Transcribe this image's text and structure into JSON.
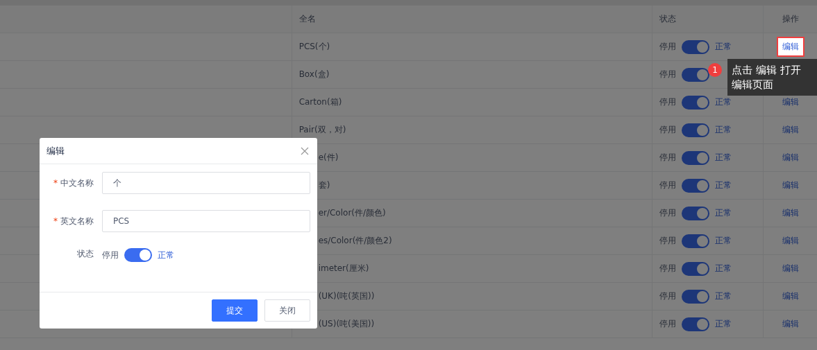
{
  "table": {
    "columns": [
      {
        "label": "全名"
      },
      {
        "label": "状态"
      },
      {
        "label": "操作"
      }
    ],
    "rows": [
      {
        "name": "PCS(个)",
        "covered": false,
        "off_label": "停用",
        "on": true,
        "on_label": "正常",
        "action": "编辑",
        "highlighted": true
      },
      {
        "name": "Box(盒)",
        "covered": false,
        "off_label": "停用",
        "on": true
      },
      {
        "name": "Carton(箱)",
        "covered": false,
        "off_label": "停用",
        "on": true,
        "on_label": "正常",
        "action": "编辑",
        "highlighted": false
      },
      {
        "name": "Pair(双，对)",
        "covered": false,
        "off_label": "停用",
        "on": true,
        "on_label": "正常",
        "action": "编辑",
        "highlighted": false
      },
      {
        "name": "e(件)",
        "covered": true,
        "off_label": "停用",
        "on": true,
        "on_label": "正常",
        "action": "编辑",
        "highlighted": false
      },
      {
        "name": "套)",
        "covered": true,
        "off_label": "停用",
        "on": true,
        "on_label": "正常",
        "action": "编辑",
        "highlighted": false
      },
      {
        "name": "er/Color(件/颜色)",
        "covered": true,
        "off_label": "停用",
        "on": true,
        "on_label": "正常",
        "action": "编辑",
        "highlighted": false
      },
      {
        "name": "es/Color(件/颜色2)",
        "covered": true,
        "off_label": "停用",
        "on": true,
        "on_label": "正常",
        "action": "编辑",
        "highlighted": false
      },
      {
        "name": "imeter(厘米)",
        "covered": true,
        "off_label": "停用",
        "on": true,
        "on_label": "正常",
        "action": "编辑",
        "highlighted": false
      },
      {
        "name": "(UK)(吨(英国))",
        "covered": true,
        "off_label": "停用",
        "on": true,
        "on_label": "正常",
        "action": "编辑",
        "highlighted": false
      },
      {
        "name": "(US)(吨(美国))",
        "covered": true,
        "off_label": "停用",
        "on": true,
        "on_label": "正常",
        "action": "编辑",
        "highlighted": false
      }
    ]
  },
  "dialog": {
    "title": "编辑",
    "fields": [
      {
        "label": "中文名称",
        "required_mark": "*",
        "value": "个"
      },
      {
        "label": "英文名称",
        "required_mark": "*",
        "value": "PCS"
      }
    ],
    "status": {
      "label": "状态",
      "off_label": "停用",
      "on": true,
      "on_label": "正常"
    },
    "buttons": [
      {
        "label": "提交",
        "primary": true
      },
      {
        "label": "关闭",
        "primary": false
      }
    ]
  },
  "tooltip": {
    "step": "1",
    "lines": [
      "点击 编辑 打开",
      "编辑页面"
    ]
  }
}
